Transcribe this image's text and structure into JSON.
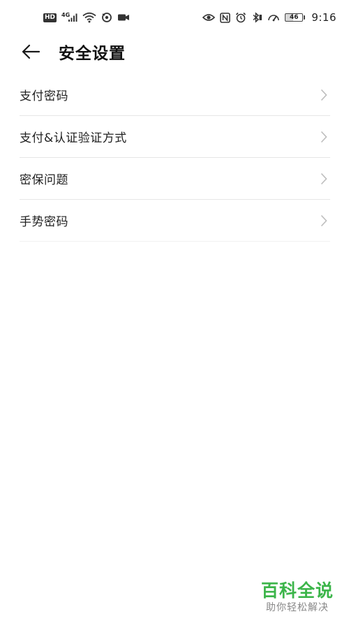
{
  "status_bar": {
    "hd_badge": "HD",
    "network_type": "4G",
    "battery_level": "46",
    "battery_fraction": 0.46,
    "time": "9:16",
    "icons": [
      "hd-icon",
      "signal-icon",
      "wifi-icon",
      "sync-icon",
      "camera-icon",
      "eye-icon",
      "nfc-icon",
      "alarm-icon",
      "bluetooth-icon",
      "speed-icon",
      "battery-icon"
    ]
  },
  "header": {
    "back_icon": "arrow-left-icon",
    "title": "安全设置"
  },
  "menu": {
    "items": [
      {
        "label": "支付密码"
      },
      {
        "label": "支付&认证验证方式"
      },
      {
        "label": "密保问题"
      },
      {
        "label": "手势密码"
      }
    ],
    "chevron_icon": "chevron-right-icon"
  },
  "watermark": {
    "title": "百科全说",
    "subtitle": "助你轻松解决"
  },
  "colors": {
    "background": "#ffffff",
    "text_primary": "#1f1f1f",
    "divider": "#e6e6e6",
    "chevron": "#bdbdbd",
    "watermark_green": "#3cb54a",
    "watermark_gray": "#888888"
  }
}
